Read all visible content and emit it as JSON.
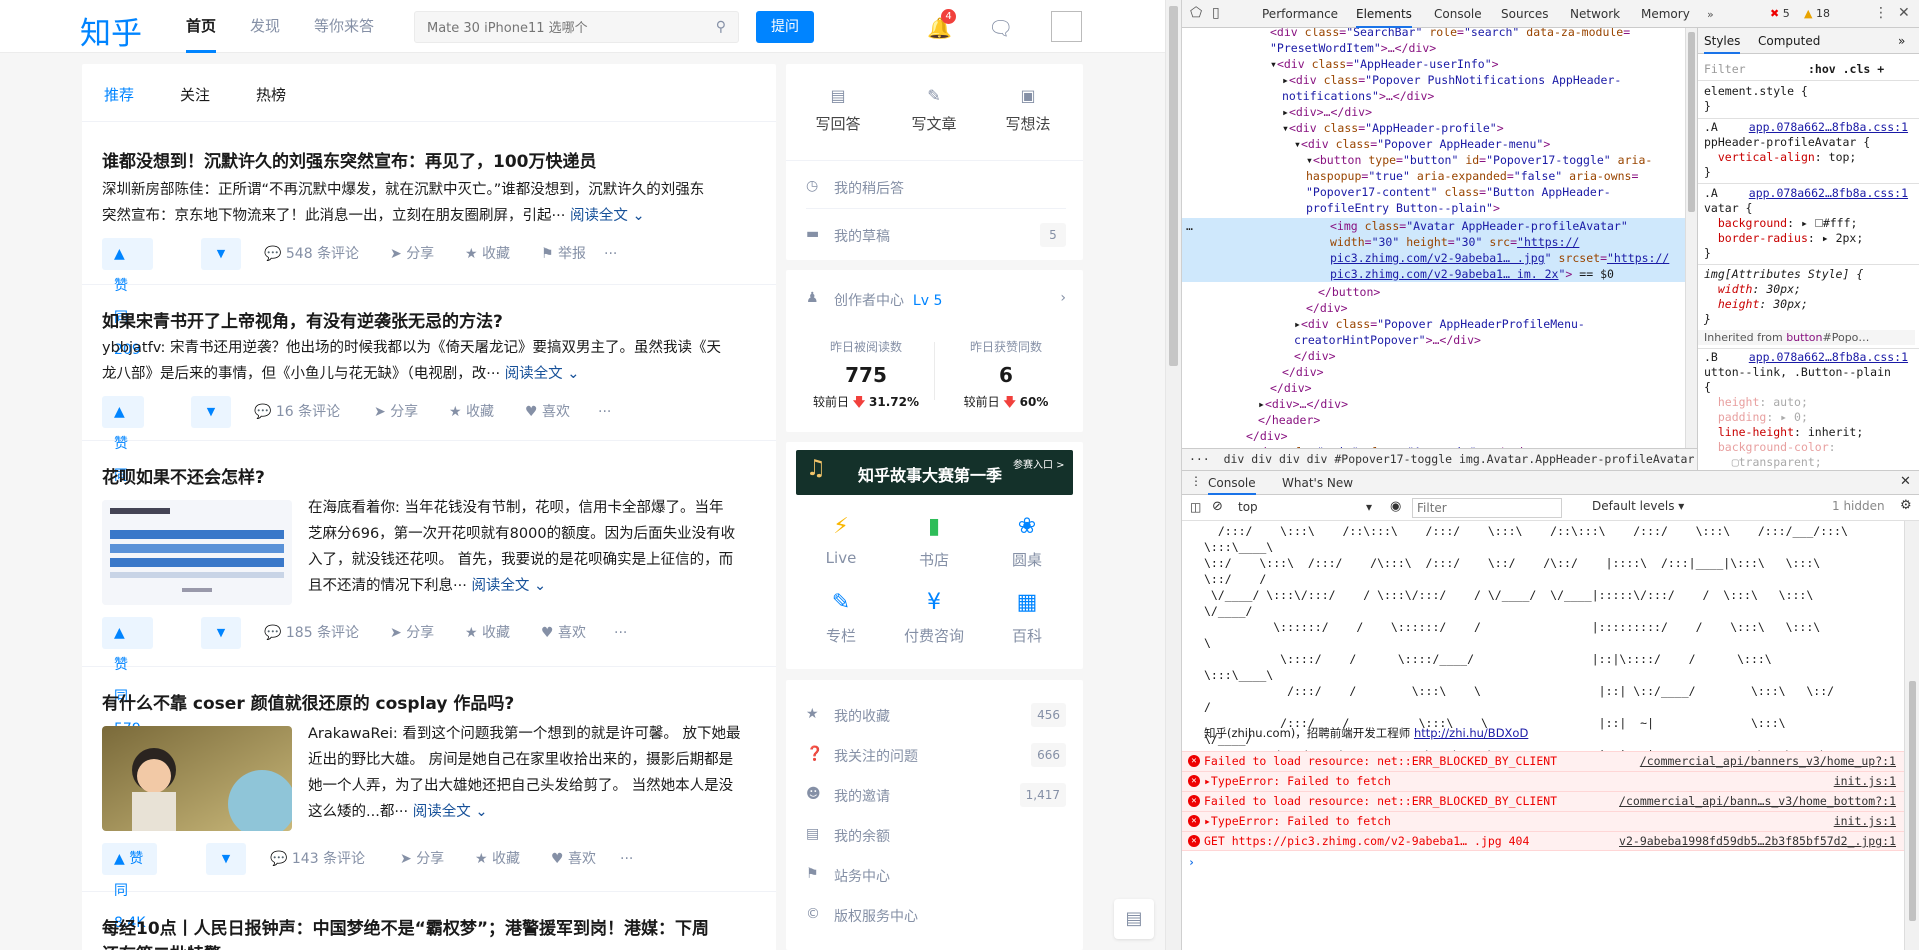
{
  "header": {
    "logo": "知乎",
    "nav": [
      "首页",
      "发现",
      "等你来答"
    ],
    "search_placeholder": "Mate 30 iPhone11 选哪个",
    "ask_label": "提问",
    "notif_count": "4"
  },
  "feed": {
    "tabs": [
      "推荐",
      "关注",
      "热榜"
    ],
    "items": [
      {
        "title": "谁都没想到！沉默许久的刘强东突然宣布：再见了，100万快递员",
        "excerpt1": "深圳新房部陈佳：正所谓“不再沉默中爆发，就在沉默中灭亡。”谁都没想到，沉默许久的刘强东",
        "excerpt2": "突然宣布：京东地下物流来了！此消息一出，立刻在朋友圈刷屏，引起···",
        "more": "阅读全文 ⌄",
        "vote": "▲ 赞同 209",
        "comments": "548 条评论",
        "share": "分享",
        "collect": "收藏",
        "extra": "举报"
      },
      {
        "title": "如果宋青书开了上帝视角，有没有逆袭张无忌的方法?",
        "excerpt1": "ybbjatfv:  宋青书还用逆袭？他出场的时候我都以为《倚天屠龙记》要搞双男主了。虽然我读《天",
        "excerpt2": "龙八部》是后来的事情，但《小鱼儿与花无缺》（电视剧，改···",
        "more": "阅读全文 ⌄",
        "vote": "▲ 赞同 52",
        "comments": "16 条评论",
        "share": "分享",
        "collect": "收藏",
        "extra": "喜欢"
      },
      {
        "title": "花呗如果不还会怎样?",
        "excerpt1": "在海底看着你:  当年花钱没有节制，花呗，信用卡全部爆了。当年",
        "excerpt2": "芝麻分696，第一次开花呗就有8000的额度。因为后面失业没有收",
        "excerpt3": "入了，就没钱还花呗。 首先，我要说的是花呗确实是上征信的，而",
        "excerpt4": "且不还清的情况下利息···",
        "more": "阅读全文 ⌄",
        "vote": "▲ 赞同 579",
        "comments": "185 条评论",
        "share": "分享",
        "collect": "收藏",
        "extra": "喜欢"
      },
      {
        "title": "有什么不靠 coser 颜值就很还原的 cosplay 作品吗?",
        "excerpt1": "ArakawaRei: 看到这个问题我第一个想到的就是许可馨。 放下她最",
        "excerpt2": "近出的野比大雄。 房间是她自己在家里收拾出来的，摄影后期都是",
        "excerpt3": "她一个人弄，为了出大雄她还把自己头发给剪了。 当然她本人是没",
        "excerpt4": "这么矮的...都···",
        "more": "阅读全文 ⌄",
        "vote": "▲ 赞同 8.4K",
        "comments": "143 条评论",
        "share": "分享",
        "collect": "收藏",
        "extra": "喜欢"
      },
      {
        "title": "每经10点丨人民日报钟声：中国梦绝不是“霸权梦”；港警援军到岗！港媒：下周",
        "title2": "还有第二批特警"
      }
    ]
  },
  "sidebar": {
    "write": [
      "写回答",
      "写文章",
      "写想法"
    ],
    "later": "我的稍后答",
    "drafts": "我的草稿",
    "drafts_count": "5",
    "creator": "创作者中心",
    "level": "Lv 5",
    "read_label": "昨日被阅读数",
    "read_value": "775",
    "read_change_label": "较前日",
    "read_change": "31.72%",
    "like_label": "昨日获赞同数",
    "like_value": "6",
    "like_change_label": "较前日",
    "like_change": "60%",
    "banner": "知乎故事大赛第一季",
    "banner_cta": "参赛入口 >",
    "grid": [
      "Live",
      "书店",
      "圆桌",
      "专栏",
      "付费咨询",
      "百科"
    ],
    "links": [
      {
        "label": "我的收藏",
        "count": "456"
      },
      {
        "label": "我关注的问题",
        "count": "666"
      },
      {
        "label": "我的邀请",
        "count": "1,417"
      },
      {
        "label": "我的余额",
        "count": ""
      },
      {
        "label": "站务中心",
        "count": ""
      },
      {
        "label": "版权服务中心",
        "count": ""
      }
    ]
  },
  "devtools": {
    "tabs": [
      "Performance",
      "Elements",
      "Console",
      "Sources",
      "Network",
      "Memory"
    ],
    "errors": "5",
    "warnings": "18",
    "crumbs": "div  div  div  div  #Popover17-toggle  img.Avatar.AppHeader-profileAvatar",
    "style_tabs": [
      "Styles",
      "Computed"
    ],
    "filter": "Filter",
    "hov": ":hov  .cls  +",
    "console_tabs": [
      "Console",
      "What's New"
    ],
    "context": "top",
    "levels": "Default levels ▾",
    "hidden": "1 hidden",
    "recruit": "知乎(zhihu.com)，招聘前端开发工程师",
    "recruit_link": "http://zhi.hu/BDXoD",
    "msgs": [
      {
        "text": "Failed to load resource: net::ERR_BLOCKED_BY_CLIENT",
        "src": "/commercial_api/banners_v3/home_up?:1"
      },
      {
        "text": "▸TypeError: Failed to fetch",
        "src": "init.js:1"
      },
      {
        "text": "Failed to load resource: net::ERR_BLOCKED_BY_CLIENT",
        "src": "/commercial_api/bann…s_v3/home_bottom?:1"
      },
      {
        "text": "▸TypeError: Failed to fetch",
        "src": "init.js:1"
      },
      {
        "text": "GET https://pic3.zhimg.com/v2-9abeba1… .jpg 404",
        "src": "v2-9abeba1998fd59db5…2b3f85bf57d2_.jpg:1"
      }
    ]
  },
  "colors": {
    "brand": "#0084ff",
    "error": "#e00000",
    "selected": "#cfe8fc"
  }
}
